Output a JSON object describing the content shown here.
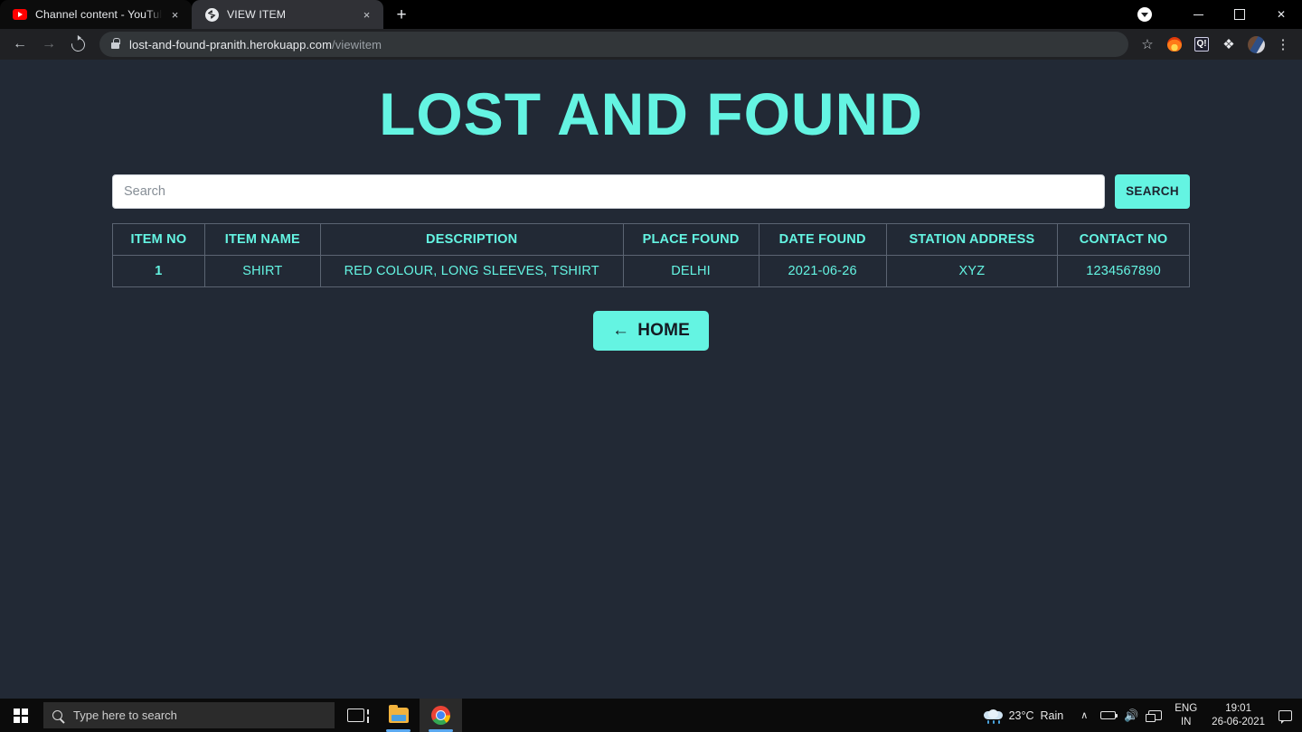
{
  "browser": {
    "tabs": [
      {
        "title": "Channel content - YouTube Studi",
        "favicon": "youtube-icon",
        "active": false
      },
      {
        "title": "VIEW ITEM",
        "favicon": "globe-icon",
        "active": true
      }
    ],
    "new_tab_label": "+",
    "close_label": "×",
    "window_controls": {
      "minimize": "—",
      "maximize": "❐",
      "close": "✕"
    },
    "nav": {
      "back": "←",
      "forward": "→",
      "reload": "reload-icon"
    },
    "omnibox": {
      "domain": "lost-and-found-pranith.herokuapp.com",
      "path": "/viewitem",
      "lock": "lock-icon"
    },
    "toolbar_icons": [
      "bookmark-star-icon",
      "extension-fire-icon",
      "extension-q-icon",
      "extensions-puzzle-icon",
      "profile-avatar",
      "chrome-menu-icon"
    ],
    "star_glyph": "☆",
    "puzzle_glyph": "❖",
    "kebab_glyph": "⋮",
    "ext_q_label": "Q!"
  },
  "page": {
    "title": "LOST AND FOUND",
    "accent_color": "#64f4e2",
    "background_color": "#222935",
    "search": {
      "placeholder": "Search",
      "value": "",
      "button_label": "SEARCH"
    },
    "table": {
      "headers": [
        "ITEM NO",
        "ITEM NAME",
        "DESCRIPTION",
        "PLACE FOUND",
        "DATE FOUND",
        "STATION ADDRESS",
        "CONTACT NO"
      ],
      "rows": [
        {
          "item_no": "1",
          "item_name": "SHIRT",
          "description": "RED COLOUR, LONG SLEEVES, TSHIRT",
          "place_found": "DELHI",
          "date_found": "2021-06-26",
          "station_address": "XYZ",
          "contact_no": "1234567890"
        }
      ]
    },
    "home_button": {
      "arrow": "←",
      "label": "HOME"
    }
  },
  "taskbar": {
    "start_label": "windows-logo",
    "search_placeholder": "Type here to search",
    "apps": [
      {
        "name": "task-view-icon"
      },
      {
        "name": "file-explorer-icon"
      },
      {
        "name": "google-chrome-icon"
      }
    ],
    "weather": {
      "temperature": "23°C",
      "condition": "Rain"
    },
    "tray": {
      "chevron": "∧",
      "battery": "battery-icon",
      "volume": "🔊",
      "network": "network-icon"
    },
    "language": {
      "line1": "ENG",
      "line2": "IN"
    },
    "clock": {
      "time": "19:01",
      "date": "26-06-2021"
    },
    "action_center": "notifications-icon"
  }
}
